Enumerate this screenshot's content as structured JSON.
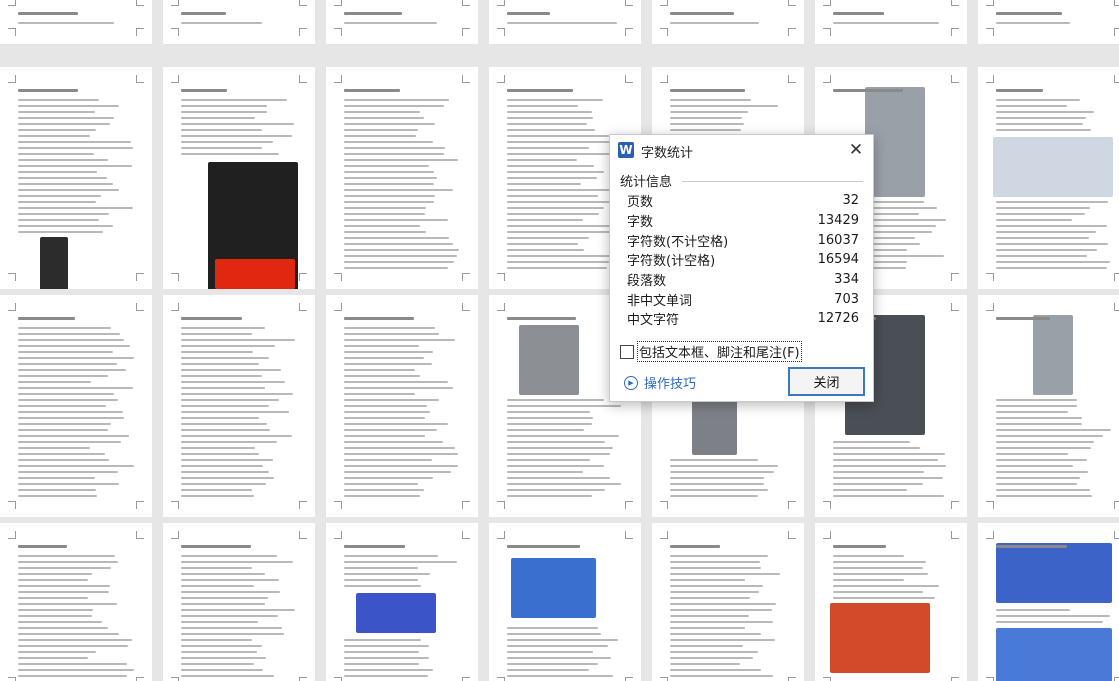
{
  "dialog": {
    "icon": "W",
    "title": "字数统计",
    "close_icon": "✕",
    "section_label": "统计信息",
    "stats": [
      {
        "label": "页数",
        "value": "32"
      },
      {
        "label": "字数",
        "value": "13429"
      },
      {
        "label": "字符数(不计空格)",
        "value": "16037"
      },
      {
        "label": "字符数(计空格)",
        "value": "16594"
      },
      {
        "label": "段落数",
        "value": "334"
      },
      {
        "label": "非中文单词",
        "value": "703"
      },
      {
        "label": "中文字符",
        "value": "12726"
      }
    ],
    "checkbox_label": "包括文本框、脚注和尾注(F)",
    "checkbox_checked": false,
    "tips_icon": "▶",
    "tips_label": "操作技巧",
    "ok_label": "关闭"
  },
  "colors": {
    "accent": "#2b5eb6",
    "link": "#2f6ac0",
    "button_border": "#3b78c4"
  }
}
